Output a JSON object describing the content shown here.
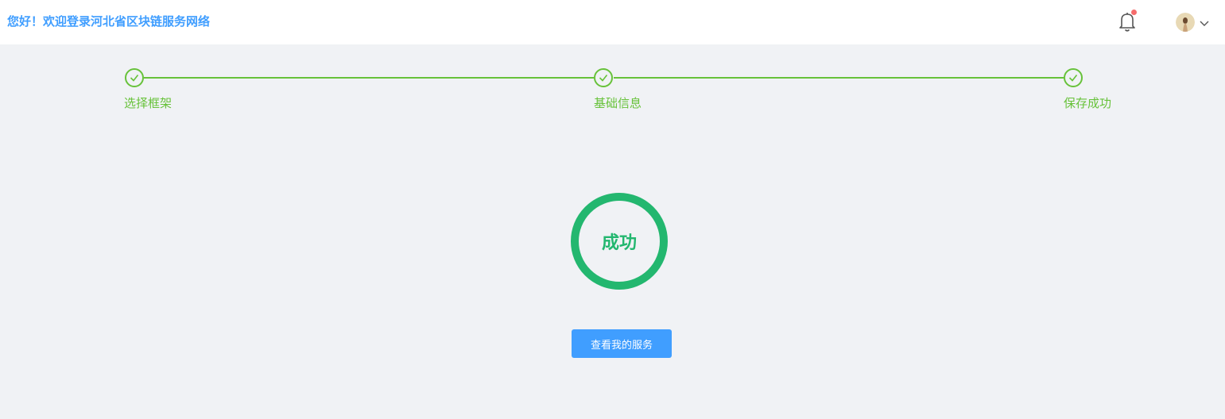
{
  "header": {
    "welcome_text": "您好！欢迎登录河北省区块链服务网络",
    "notification_badge": true
  },
  "steps": [
    {
      "title": "选择框架",
      "status": "success"
    },
    {
      "title": "基础信息",
      "status": "success"
    },
    {
      "title": "保存成功",
      "status": "success"
    }
  ],
  "result": {
    "text": "成功"
  },
  "actions": {
    "view_services_label": "查看我的服务"
  },
  "colors": {
    "brand": "#409eff",
    "step_success": "#67c23a",
    "result_success": "#23b76f",
    "badge": "#f56c6c",
    "background": "#f0f2f5"
  }
}
